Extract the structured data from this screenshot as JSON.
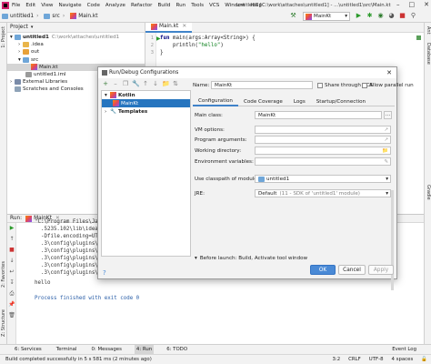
{
  "menu": {
    "items": [
      "File",
      "Edit",
      "View",
      "Navigate",
      "Code",
      "Analyze",
      "Refactor",
      "Build",
      "Run",
      "Tools",
      "VCS",
      "Window",
      "Help"
    ],
    "title": "untitled1 [C:\\work\\attaches\\untitled1] - ...\\untitled1\\src\\Main.kt"
  },
  "navbar": {
    "crumbs": [
      "untitled1",
      "src",
      "Main.kt"
    ],
    "run_config": "MainKt"
  },
  "project": {
    "header": "Project",
    "rows": [
      {
        "text": "untitled1",
        "suffix": "C:\\work\\attaches\\untitled1",
        "indent": 0
      },
      {
        "text": ".idea",
        "suffix": "",
        "indent": 1
      },
      {
        "text": "out",
        "suffix": "",
        "indent": 1
      },
      {
        "text": "src",
        "suffix": "",
        "indent": 1
      },
      {
        "text": "Main.kt",
        "suffix": "",
        "indent": 2
      },
      {
        "text": "untitled1.iml",
        "suffix": "",
        "indent": 2
      },
      {
        "text": "External Libraries",
        "suffix": "",
        "indent": 0
      },
      {
        "text": "Scratches and Consoles",
        "suffix": "",
        "indent": 0
      }
    ]
  },
  "editor": {
    "tab": "Main.kt",
    "lines": [
      {
        "num": "1",
        "kw": "fun",
        "rest": " main(args:Array<String>) {"
      },
      {
        "num": "2",
        "kw": "",
        "rest": "    println(",
        "str": "\"hello\"",
        "tail": ")"
      },
      {
        "num": "3",
        "kw": "",
        "rest": "}"
      }
    ]
  },
  "run": {
    "header_prefix": "Run:",
    "tab": "MainKt",
    "output": [
      "\"C:\\Program Files\\Ja",
      "  .5235.102\\lib\\idea_",
      "  -Dfile.encoding=UTF",
      "  .3\\config\\plugins\\K",
      "  .3\\config\\plugins\\K",
      "  .3\\config\\plugins\\K",
      "  .3\\config\\plugins\\K",
      "  .3\\config\\plugins\\K",
      "hello",
      "",
      "Process finished with exit code 0"
    ]
  },
  "bottom_tabs": [
    "6: Services",
    "Terminal",
    "0: Messages",
    "4: Run",
    "6: TODO"
  ],
  "status": {
    "message": "Build completed successfully in 5 s 581 ms (2 minutes ago)",
    "position": "3:2",
    "line_sep": "CRLF",
    "encoding": "UTF-8",
    "indent": "4 spaces",
    "event_log": "Event Log"
  },
  "stripes": {
    "left": [
      "1: Project",
      "2: Favorites",
      "Z: Structure"
    ],
    "right": [
      "Ant",
      "Database",
      "Gradle"
    ]
  },
  "dialog": {
    "title": "Run/Debug Configurations",
    "tree": [
      {
        "text": "Kotlin",
        "indent": 0,
        "sel": false,
        "bold": true
      },
      {
        "text": "MainKt",
        "indent": 1,
        "sel": true,
        "bold": false
      },
      {
        "text": "Templates",
        "indent": 0,
        "sel": false,
        "bold": true
      }
    ],
    "name_label": "Name:",
    "name_value": "MainKt",
    "share_label": "Share through VCS",
    "parallel_label": "Allow parallel run",
    "tabs": [
      "Configuration",
      "Code Coverage",
      "Logs",
      "Startup/Connection"
    ],
    "fields": {
      "main_class_label": "Main class:",
      "main_class_value": "MainKt",
      "vm_options_label": "VM options:",
      "program_args_label": "Program arguments:",
      "working_dir_label": "Working directory:",
      "env_vars_label": "Environment variables:",
      "classpath_label": "Use classpath of module:",
      "classpath_value": "untitled1",
      "jre_label": "JRE:",
      "jre_value": "Default",
      "jre_hint": "(11 - SDK of 'untitled1' module)"
    },
    "before_launch": "Before launch: Build, Activate tool window",
    "ok": "OK",
    "cancel": "Cancel",
    "apply": "Apply"
  },
  "colors": {
    "accent": "#4083c9",
    "selection": "#2675bf",
    "keyword": "#000080",
    "string": "#067d17"
  }
}
